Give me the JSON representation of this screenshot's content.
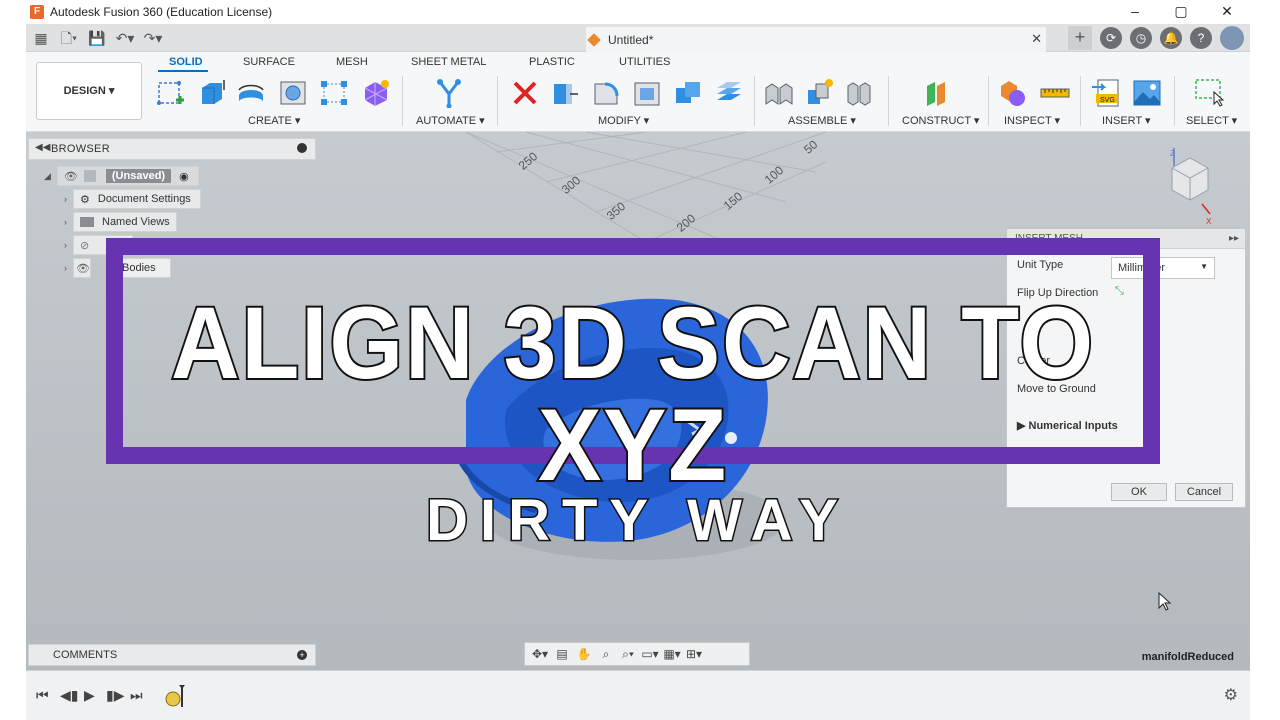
{
  "window": {
    "title": "Autodesk Fusion 360 (Education License)",
    "controls": [
      "–",
      "▢",
      "✕"
    ]
  },
  "tabbar": {
    "doc_tab": "Untitled*",
    "close": "✕",
    "plus": "+"
  },
  "ribbon": {
    "workspace": "DESIGN ▾",
    "tabs": [
      "SOLID",
      "SURFACE",
      "MESH",
      "SHEET METAL",
      "PLASTIC",
      "UTILITIES"
    ],
    "active_tab": "SOLID",
    "groups": [
      "CREATE ▾",
      "AUTOMATE ▾",
      "MODIFY ▾",
      "ASSEMBLE ▾",
      "CONSTRUCT ▾",
      "INSPECT ▾",
      "INSERT ▾",
      "SELECT ▾"
    ]
  },
  "browser": {
    "title": "BROWSER",
    "root": "(Unsaved)",
    "items": [
      "Document Settings",
      "Named Views",
      "",
      "Bodies"
    ]
  },
  "grid_labels": [
    "50",
    "250",
    "100",
    "300",
    "150",
    "350",
    "200"
  ],
  "dialog": {
    "header": "INSERT MESH",
    "unit_type_label": "Unit Type",
    "unit_type_value": "Millimeter",
    "flip_label": "Flip Up Direction",
    "center_label": "Center",
    "move_label": "Move to Ground",
    "numerical_label": "Numerical Inputs",
    "ok": "OK",
    "cancel": "Cancel"
  },
  "banner": {
    "title": "ALIGN 3D SCAN TO XYZ",
    "subtitle": "DIRTY WAY"
  },
  "mesh_name": "manifoldReduced",
  "comments": {
    "title": "COMMENTS"
  },
  "colors": {
    "accent": "#0a6ebd",
    "banner_border": "#6634b1",
    "mesh_body": "#2a66d9"
  }
}
